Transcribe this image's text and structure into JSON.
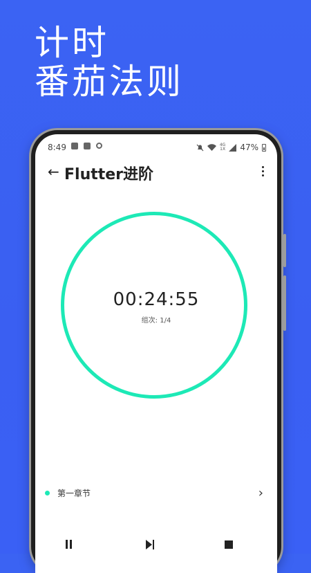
{
  "promo": {
    "line1": "计时",
    "line2": "番茄法则"
  },
  "status_bar": {
    "time": "8:49",
    "net_top": "4G",
    "net_bottom": "1X",
    "battery": "47%"
  },
  "app_bar": {
    "back_icon": "arrow-left-icon",
    "title": "Flutter进阶",
    "more_icon": "more-vert-icon"
  },
  "timer": {
    "display": "00:24:55",
    "rounds": "组次: 1/4",
    "ring_color": "#1de9b6"
  },
  "chapter": {
    "label": "第一章节",
    "dot_color": "#1de9b6"
  },
  "controls": {
    "pause_icon": "pause-icon",
    "next_icon": "skip-next-icon",
    "stop_icon": "stop-icon"
  },
  "colors": {
    "background": "#3b63f3",
    "text": "#222222"
  }
}
